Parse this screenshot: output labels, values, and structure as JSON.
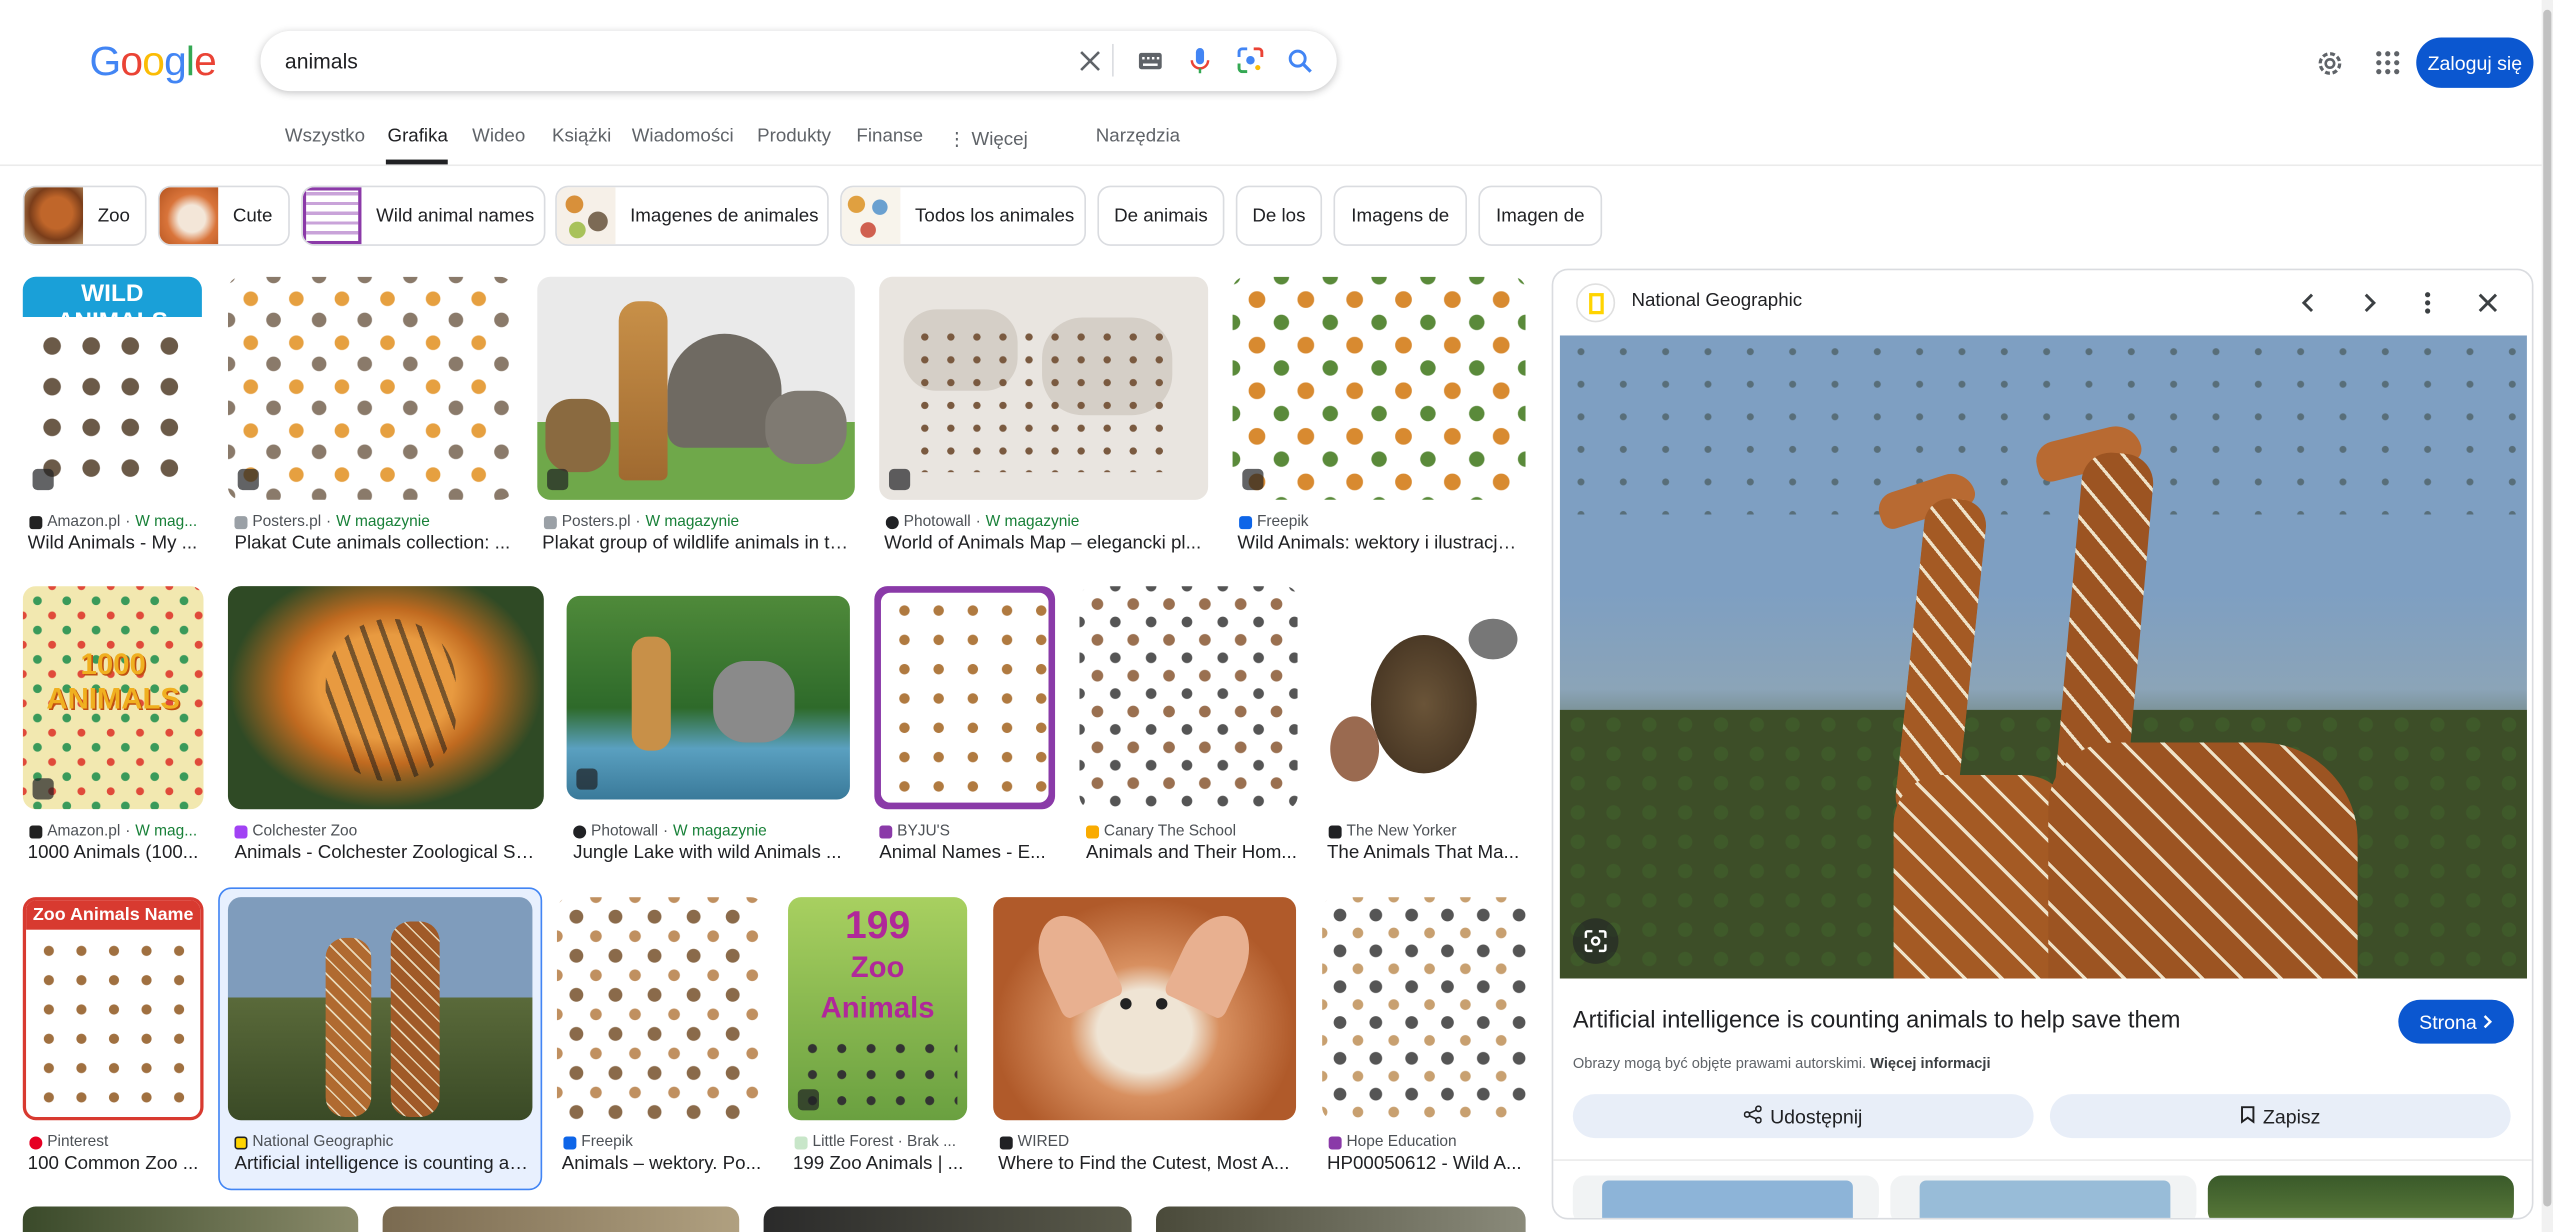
{
  "logo": {
    "letters": [
      "G",
      "o",
      "o",
      "g",
      "l",
      "e"
    ]
  },
  "search": {
    "query": "animals"
  },
  "header": {
    "signin_label": "Zaloguj się"
  },
  "tabs": [
    {
      "label": "Wszystko"
    },
    {
      "label": "Grafika"
    },
    {
      "label": "Wideo"
    },
    {
      "label": "Książki"
    },
    {
      "label": "Wiadomości"
    },
    {
      "label": "Produkty"
    },
    {
      "label": "Finanse"
    },
    {
      "label": "Więcej"
    },
    {
      "label": "Narzędzia"
    }
  ],
  "chips": [
    {
      "label": "Zoo"
    },
    {
      "label": "Cute"
    },
    {
      "label": "Wild animal names"
    },
    {
      "label": "Imagenes de animales"
    },
    {
      "label": "Todos los animales"
    },
    {
      "label": "De animais"
    },
    {
      "label": "De los"
    },
    {
      "label": "Imagens de"
    },
    {
      "label": "Imagen de"
    }
  ],
  "results": [
    {
      "source": "Amazon.pl",
      "stock": "W mag...",
      "title": "Wild Animals - My ...",
      "image": "wild-animals-poster"
    },
    {
      "source": "Posters.pl",
      "stock": "W magazynie",
      "title": "Plakat Cute animals collection: ...",
      "image": "cute-animals-poster"
    },
    {
      "source": "Posters.pl",
      "stock": "W magazynie",
      "title": "Plakat group of wildlife animals in th...",
      "image": "wildlife-group"
    },
    {
      "source": "Photowall",
      "stock": "W magazynie",
      "title": "World of Animals Map – elegancki pl...",
      "image": "world-map"
    },
    {
      "source": "Freepik",
      "stock": "",
      "title": "Wild Animals: wektory i ilustracje...",
      "image": "wild-animals-vector"
    },
    {
      "source": "Amazon.pl",
      "stock": "W mag...",
      "title": "1000 Animals (100...",
      "image": "1000-animals-book"
    },
    {
      "source": "Colchester Zoo",
      "stock": "",
      "title": "Animals - Colchester Zoological So...",
      "image": "tiger"
    },
    {
      "source": "Photowall",
      "stock": "W magazynie",
      "title": "Jungle Lake with wild Animals ...",
      "image": "jungle-lake"
    },
    {
      "source": "BYJU'S",
      "stock": "",
      "title": "Animal Names - E...",
      "image": "animal-names-chart"
    },
    {
      "source": "Canary The School",
      "stock": "",
      "title": "Animals and Their Hom...",
      "image": "animals-homes"
    },
    {
      "source": "The New Yorker",
      "stock": "",
      "title": "The Animals That Ma...",
      "image": "illustrated-animals"
    },
    {
      "source": "Pinterest",
      "stock": "",
      "title": "100 Common Zoo ...",
      "image": "zoo-animals-names"
    },
    {
      "source": "National Geographic",
      "stock": "",
      "title": "Artificial intelligence is counting an...",
      "image": "giraffes"
    },
    {
      "source": "Freepik",
      "stock": "",
      "title": "Animals – wektory. Po...",
      "image": "animals-vectors"
    },
    {
      "source": "Little Forest · Brak ...",
      "stock": "",
      "title": "199 Zoo Animals | ...",
      "image": "199-zoo-animals"
    },
    {
      "source": "WIRED",
      "stock": "",
      "title": "Where to Find the Cutest, Most A...",
      "image": "fennec-fox"
    },
    {
      "source": "Hope Education",
      "stock": "",
      "title": "HP00050612 - Wild A...",
      "image": "wild-animal-figures"
    }
  ],
  "preview": {
    "source": "National Geographic",
    "title": "Artificial intelligence is counting animals to help save them",
    "visit_label": "Strona",
    "copyright": "Obrazy mogą być objęte prawami autorskimi.",
    "more_info": "Więcej informacji",
    "share_label": "Udostępnij",
    "save_label": "Zapisz"
  },
  "colors": {
    "accent": "#0b57d0",
    "stock_green": "#188038",
    "selection_border": "#4285f4"
  }
}
